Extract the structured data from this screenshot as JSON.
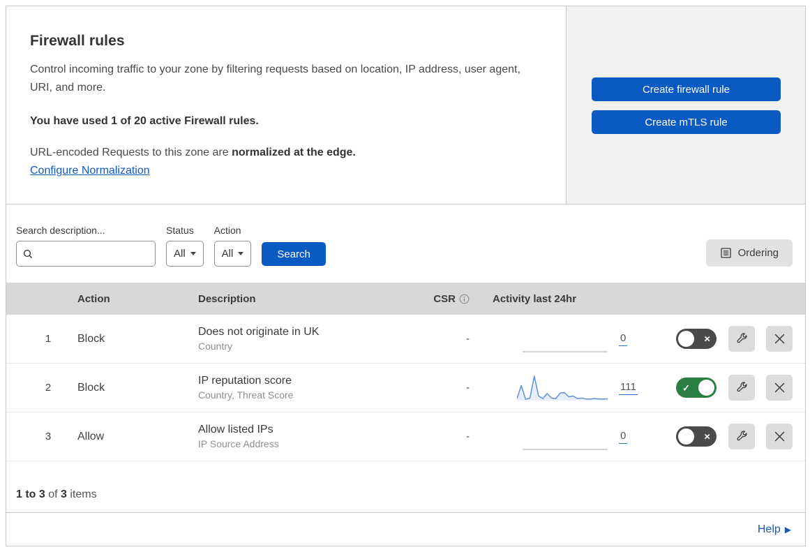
{
  "colors": {
    "primary_blue": "#0b5ac4",
    "link_blue": "#1359be",
    "toggle_on_green": "#2a7e43",
    "toggle_off_gray": "#4a4a4a",
    "sparkline_blue": "#5f90d9",
    "header_row_gray": "#d8d8d8",
    "panel_gray": "#f1f1f1"
  },
  "intro": {
    "title": "Firewall rules",
    "description": "Control incoming traffic to your zone by filtering requests based on location, IP address, user agent, URI, and more.",
    "usage_note": "You have used 1 of 20 active Firewall rules.",
    "normalization_text": "URL-encoded Requests to this zone are ",
    "normalization_bold": "normalized at the edge.",
    "normalization_link": "Configure Normalization"
  },
  "actions_panel": {
    "create_firewall_rule": "Create firewall rule",
    "create_mtls_rule": "Create mTLS rule"
  },
  "filters": {
    "search_label": "Search description...",
    "search_value": "",
    "status_label": "Status",
    "status_value": "All",
    "action_label": "Action",
    "action_value": "All",
    "search_button": "Search",
    "ordering_button": "Ordering"
  },
  "table": {
    "headers": {
      "action": "Action",
      "description": "Description",
      "csr": "CSR",
      "activity": "Activity last 24hr"
    },
    "rows": [
      {
        "number": "1",
        "action": "Block",
        "description": "Does not originate in UK",
        "fields": "Country",
        "csr": "-",
        "activity_count": "0",
        "enabled": false,
        "sparkline": []
      },
      {
        "number": "2",
        "action": "Block",
        "description": "IP reputation score",
        "fields": "Country, Threat Score",
        "csr": "-",
        "activity_count": "111",
        "enabled": true,
        "sparkline": [
          8,
          60,
          5,
          10,
          97,
          18,
          8,
          28,
          10,
          8,
          30,
          32,
          15,
          18,
          8,
          10,
          6,
          6,
          8,
          6,
          6,
          7
        ]
      },
      {
        "number": "3",
        "action": "Allow",
        "description": "Allow listed IPs",
        "fields": "IP Source Address",
        "csr": "-",
        "activity_count": "0",
        "enabled": false,
        "sparkline": []
      }
    ]
  },
  "footer": {
    "range": "1 to 3",
    "of": " of ",
    "total": "3",
    "items": " items",
    "help": "Help"
  }
}
